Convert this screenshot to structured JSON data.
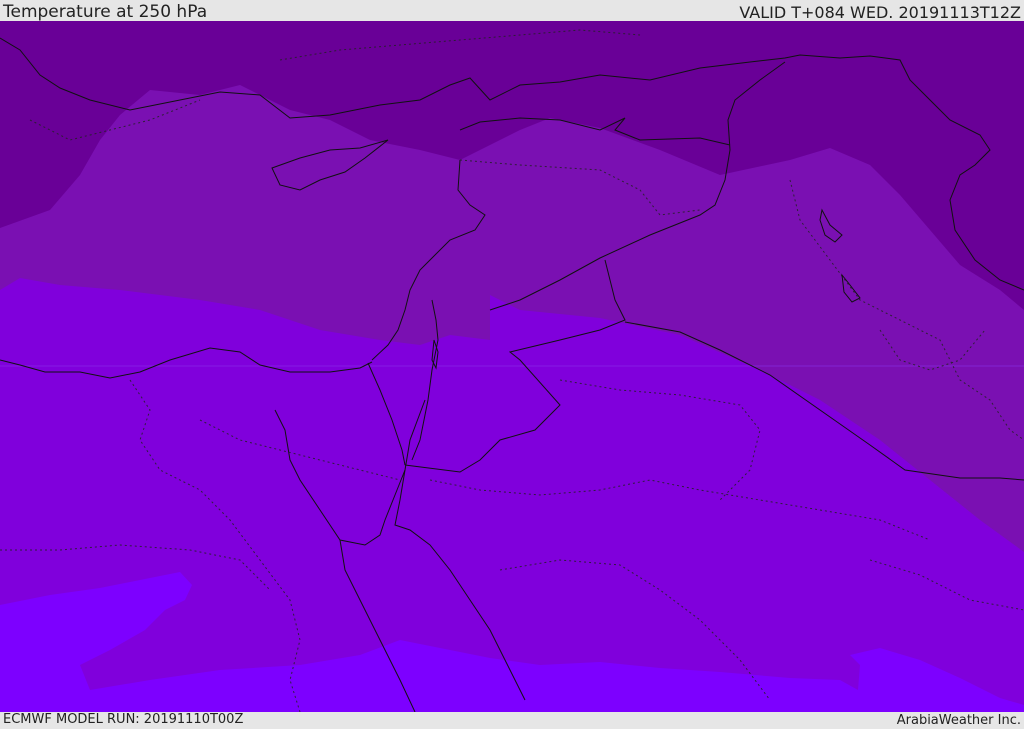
{
  "header": {
    "title": "Temperature at 250 hPa",
    "valid": "VALID T+084 WED. 20191113T12Z"
  },
  "footer": {
    "model_run": "ECMWF MODEL RUN: 20191110T00Z",
    "credit": "ArabiaWeather Inc."
  },
  "map": {
    "field": "temperature",
    "level": "250 hPa",
    "bands": [
      {
        "name": "band-coldest",
        "color": "#690097"
      },
      {
        "name": "band-cold",
        "color": "#7a10b2"
      },
      {
        "name": "band-mid",
        "color": "#8000dc"
      },
      {
        "name": "band-warm",
        "color": "#7d00ff"
      }
    ],
    "border_color": "#111111"
  }
}
